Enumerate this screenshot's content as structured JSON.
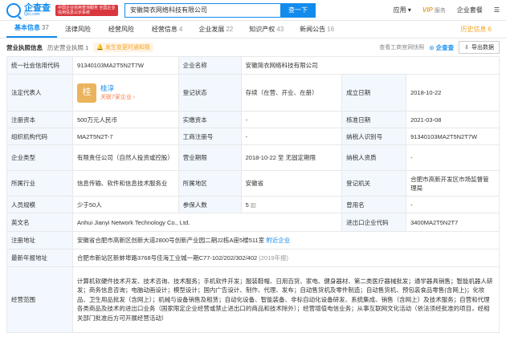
{
  "header": {
    "logo_name": "企查查",
    "logo_domain": "Qcc.com",
    "badge": "中国企业信用查询服务 全国企业信用信息公示系统",
    "search_value": "安徽简衣网络科技有限公司",
    "search_button": "查一下",
    "nav": {
      "app": "应用",
      "vip": "VIP",
      "vip_sub": "服务",
      "suite": "企业套餐"
    }
  },
  "tabs": [
    {
      "label": "基本信息",
      "count": "37"
    },
    {
      "label": "法律风险",
      "count": ""
    },
    {
      "label": "经营风险",
      "count": ""
    },
    {
      "label": "经营信息",
      "count": "4"
    },
    {
      "label": "企业发展",
      "count": "22"
    },
    {
      "label": "知识产权",
      "count": "43"
    },
    {
      "label": "新闻公告",
      "count": "16"
    },
    {
      "label": "历史信息",
      "count": "6"
    }
  ],
  "subbar": {
    "title": "营业执照信息",
    "history": "历史营业执照",
    "history_count": "1",
    "notice": "发生变更时通知我",
    "view_link": "查看工商官网快照",
    "brand": "企查查",
    "export": "导出数据"
  },
  "info": {
    "credit_code_k": "统一社会信用代码",
    "credit_code": "91340103MA2T5N2T7W",
    "name_k": "企业名称",
    "name": "安徽简衣网络科技有限公司",
    "legal_k": "法定代表人",
    "legal_avatar": "桂",
    "legal_name": "桂淳",
    "legal_more": "关联7家企业 ›",
    "reg_status_k": "登记状态",
    "reg_status": "存续（在营、开业、在册）",
    "est_date_k": "成立日期",
    "est_date": "2018-10-22",
    "reg_cap_k": "注册资本",
    "reg_cap": "500万元人民币",
    "paid_cap_k": "实缴资本",
    "paid_cap": "-",
    "approve_k": "核准日期",
    "approve": "2021-03-08",
    "org_code_k": "组织机构代码",
    "org_code": "MA2T5N2T-7",
    "biz_reg_k": "工商注册号",
    "biz_reg": "-",
    "tax_id_k": "纳税人识别号",
    "tax_id": "91340103MA2T5N2T7W",
    "type_k": "企业类型",
    "type": "有限责任公司（自然人投资或控股）",
    "term_k": "营业期限",
    "term": "2018-10-22 至 无固定期限",
    "taxpayer_k": "纳税人资质",
    "taxpayer": "-",
    "industry_k": "所属行业",
    "industry": "信息传输、软件和信息技术服务业",
    "region_k": "所属地区",
    "region": "安徽省",
    "authority_k": "登记机关",
    "authority": "合肥市高新开发区市场监督管理局",
    "staff_k": "人员规模",
    "staff": "少于50人",
    "insured_k": "参保人数",
    "insured": "5",
    "used_name_k": "曾用名",
    "used_name": "-",
    "en_name_k": "英文名",
    "en_name": "Anhui Jianyi Network Technology Co., Ltd.",
    "import_k": "进出口企业代码",
    "import": "3400MA2T5N2T7",
    "address_k": "注册地址",
    "address": "安徽省合肥市高新区创新大道2800号创新产业园二期J2栋A座5楼511室",
    "address_link": "附近企业",
    "annual_k": "最新年报地址",
    "annual": "合肥市新站区新蚌埠路3768号佳海工业城一期C77-102/202/302/402",
    "annual_year": "(2019年报)",
    "scope_k": "经营范围",
    "scope": "计算机软硬件技术开发、技术咨询、技术服务；手机软件开发；服装鞋帽、日用百货、家电、健身器材、第二类医疗器械批发；通学器具销售；智能机器人研发；商务信息咨询；电脑动画设计；模型设计；国内广告设计、制作、代理、发布；自动售货机及零件制造；自动售货机、预包装食品零售(含网上)；化妆品、卫生用品批发（含网上）；机械与设备销售及租赁；自动化设备、智能装备、非标自动化设备研发、系统集成、销售（含网上）及技术服务；自营和代理各类商品及技术的进出口业务（国家限定企业经营或禁止进出口的商品和技术除外）；经营增值电信业务；从事互联网文化活动（依法须经批准的项目，经相关部门批准后方可开展经营活动）"
  },
  "colors": {
    "brand": "#128bed",
    "header_cell": "#f2f8fe",
    "history": "#f5a623",
    "badge": "#d9363e"
  }
}
